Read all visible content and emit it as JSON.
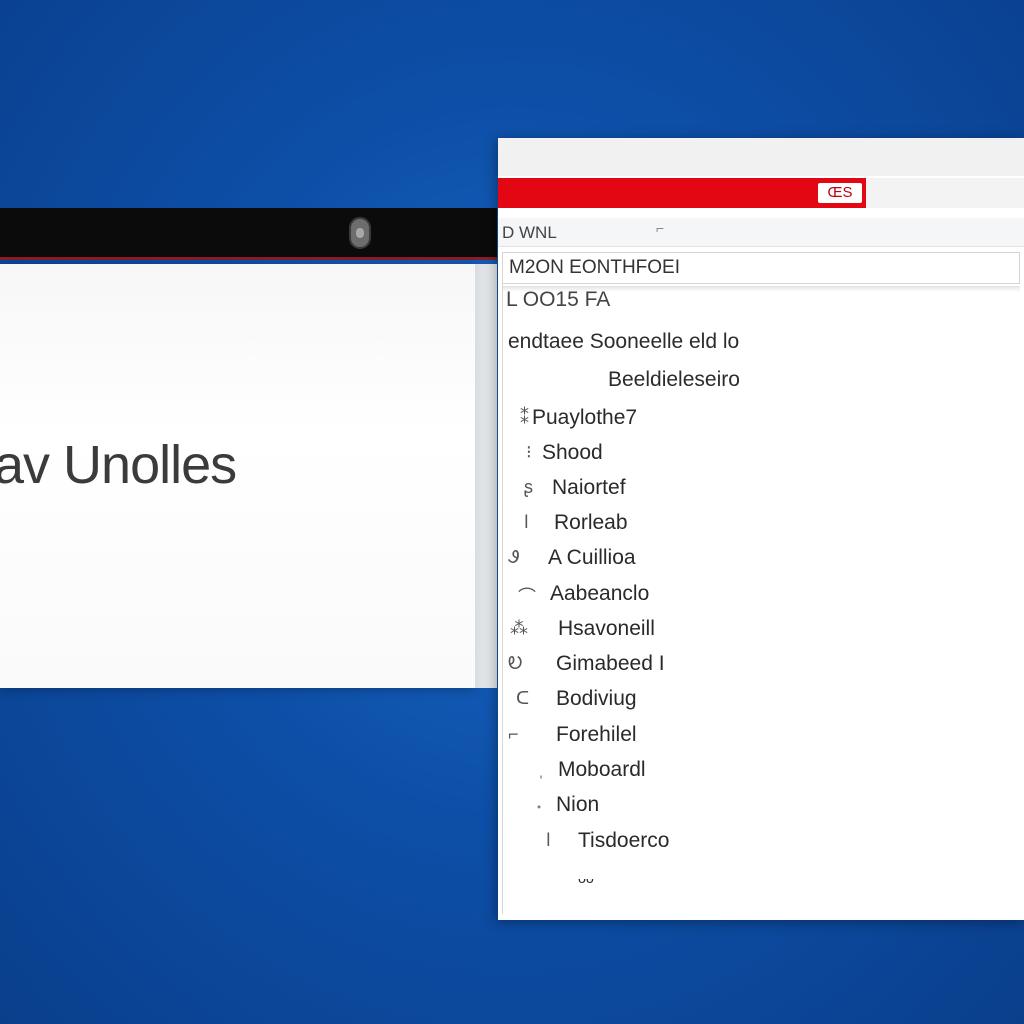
{
  "left_window": {
    "title": "av Unolles"
  },
  "right_window": {
    "badge": "ŒS",
    "header_label": "D WNL",
    "header_mark": "⌐",
    "search_value": "M2ON EONTHFOEI",
    "field_label": "L OO15 FA",
    "sentence": "endtaee Sooneelle eld lo",
    "subheading": "Beeldieleseiro",
    "items": [
      {
        "icon": "⁑",
        "label": "Puaylothe7"
      },
      {
        "icon": "⁝",
        "label": "Shood"
      },
      {
        "icon": "ʂ",
        "label": "Naiortef"
      },
      {
        "icon": "ǀ",
        "label": "Rorleab"
      },
      {
        "icon": "Ꮽ",
        "label": "A Cuillioa"
      },
      {
        "icon": "⌒",
        "label": "Aabeanclo"
      },
      {
        "icon": "⁂",
        "label": "Hsavoneill"
      },
      {
        "icon": "Ꭷ",
        "label": "Gimabeed I"
      },
      {
        "icon": "ᑕ",
        "label": "Bodiviug"
      },
      {
        "icon": "⌐",
        "label": "Forehilel"
      },
      {
        "icon": "ˌ",
        "label": "Moboardl"
      },
      {
        "icon": "˖",
        "label": "Nion"
      },
      {
        "icon": "ǀ",
        "label": "Tisdoerco"
      },
      {
        "icon": "",
        "label": "ᵕᵕ"
      }
    ]
  },
  "colors": {
    "accent_red": "#e30613",
    "desktop_blue": "#0d4fa8"
  }
}
